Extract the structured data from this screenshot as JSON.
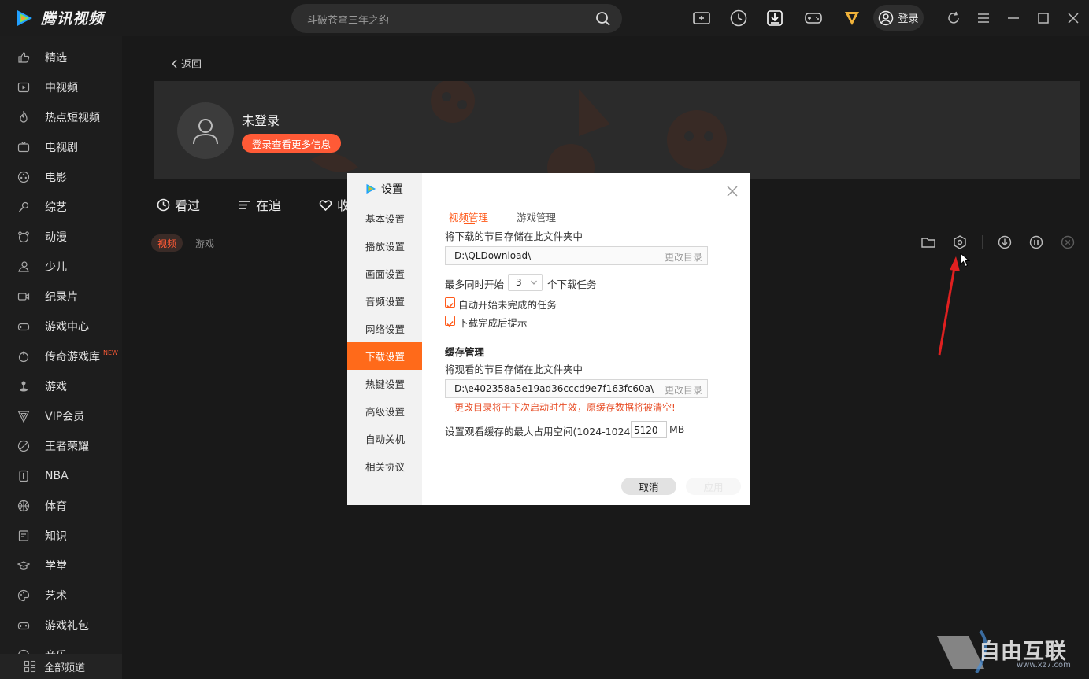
{
  "app": {
    "name": "腾讯视频"
  },
  "search": {
    "placeholder": "斗破苍穹三年之约"
  },
  "header": {
    "login_label": "登录"
  },
  "sidebar": {
    "items": [
      {
        "label": "精选",
        "icon": "thumb-icon"
      },
      {
        "label": "中视频",
        "icon": "play-square-icon"
      },
      {
        "label": "热点短视频",
        "icon": "flame-icon"
      },
      {
        "label": "电视剧",
        "icon": "tv-icon"
      },
      {
        "label": "电影",
        "icon": "film-reel-icon"
      },
      {
        "label": "综艺",
        "icon": "mic-icon"
      },
      {
        "label": "动漫",
        "icon": "bear-icon"
      },
      {
        "label": "少儿",
        "icon": "kid-icon"
      },
      {
        "label": "纪录片",
        "icon": "camera-icon"
      },
      {
        "label": "游戏中心",
        "icon": "gamepad-icon"
      },
      {
        "label": "传奇游戏库",
        "icon": "sword-icon",
        "badge": "NEW"
      },
      {
        "label": "游戏",
        "icon": "joystick-icon"
      },
      {
        "label": "VIP会员",
        "icon": "vip-icon"
      },
      {
        "label": "王者荣耀",
        "icon": "compass-icon"
      },
      {
        "label": "NBA",
        "icon": "nba-icon"
      },
      {
        "label": "体育",
        "icon": "ball-icon"
      },
      {
        "label": "知识",
        "icon": "book-icon"
      },
      {
        "label": "学堂",
        "icon": "cap-icon"
      },
      {
        "label": "艺术",
        "icon": "palette-icon"
      },
      {
        "label": "游戏礼包",
        "icon": "gift-gamepad-icon"
      },
      {
        "label": "音乐",
        "icon": "music-icon"
      }
    ],
    "all_channels": "全部频道"
  },
  "main": {
    "back": "返回",
    "user": {
      "name": "未登录",
      "login_button": "登录查看更多信息"
    },
    "tabs": [
      "看过",
      "在追",
      "收"
    ],
    "chips": [
      "视频",
      "游戏"
    ]
  },
  "dialog": {
    "title": "设置",
    "nav": [
      "基本设置",
      "播放设置",
      "画面设置",
      "音频设置",
      "网络设置",
      "下载设置",
      "热键设置",
      "高级设置",
      "自动关机",
      "相关协议"
    ],
    "active_nav": "下载设置",
    "tabs": {
      "video": "视频管理",
      "game": "游戏管理"
    },
    "download_folder_label": "将下载的节目存储在此文件夹中",
    "download_path": "D:\\QLDownload\\",
    "change_dir": "更改目录",
    "max_concurrent_prefix": "最多同时开始",
    "max_concurrent_value": "3",
    "max_concurrent_suffix": "个下载任务",
    "auto_start_label": "自动开始未完成的任务",
    "notify_label": "下载完成后提示",
    "cache_title": "缓存管理",
    "cache_folder_label": "将观看的节目存储在此文件夹中",
    "cache_path": "D:\\e402358a5e19ad36cccd9e7f163fc60a\\",
    "cache_warning": "更改目录将于下次启动时生效，原缓存数据将被清空!",
    "cache_size_label": "设置观看缓存的最大占用空间(1024-10240)",
    "cache_size_value": "5120",
    "cache_size_unit": "MB",
    "cancel": "取消",
    "apply": "应用"
  },
  "watermark": {
    "text": "自由互联",
    "url": "www.xz7.com"
  },
  "colors": {
    "accent": "#ff5a36",
    "dialog_accent": "#ff6a1a",
    "background": "#191919"
  }
}
